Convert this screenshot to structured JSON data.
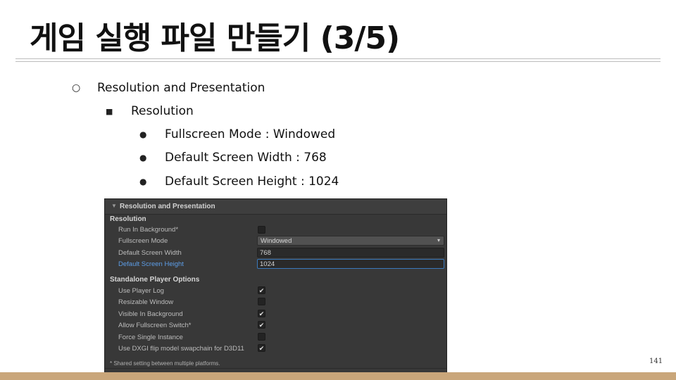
{
  "slide": {
    "title": "게임 실행 파일 만들기 (3/5)",
    "page_number": "141"
  },
  "bullets": {
    "level1_marker": "○",
    "level2_marker": "■",
    "level3_marker": "●",
    "item1": "Resolution and Presentation",
    "item2": "Resolution",
    "item3": "Fullscreen Mode : Windowed",
    "item4": "Default Screen Width : 768",
    "item5": "Default Screen Height : 1024"
  },
  "inspector": {
    "header_arrow": "▼",
    "header_title": "Resolution and Presentation",
    "section_resolution": "Resolution",
    "run_in_background": {
      "label": "Run In Background*",
      "checked": false
    },
    "fullscreen_mode": {
      "label": "Fullscreen Mode",
      "value": "Windowed",
      "arrow": "▾"
    },
    "default_screen_width": {
      "label": "Default Screen Width",
      "value": "768"
    },
    "default_screen_height": {
      "label": "Default Screen Height",
      "value": "1024"
    },
    "section_standalone": "Standalone Player Options",
    "use_player_log": {
      "label": "Use Player Log",
      "checked": true
    },
    "resizable_window": {
      "label": "Resizable Window",
      "checked": false
    },
    "visible_in_background": {
      "label": "Visible In Background",
      "checked": true
    },
    "allow_fullscreen_switch": {
      "label": "Allow Fullscreen Switch*",
      "checked": true
    },
    "force_single_instance": {
      "label": "Force Single Instance",
      "checked": false
    },
    "use_dxgi_flip": {
      "label": "Use DXGI flip model swapchain for D3D11",
      "checked": true
    },
    "check_glyph": "✔",
    "footnote": "* Shared setting between multiple platforms."
  },
  "colors": {
    "panel_bg": "#383838",
    "accent_blue": "#5d9ee8",
    "bottom_bar": "#c9a67a"
  }
}
